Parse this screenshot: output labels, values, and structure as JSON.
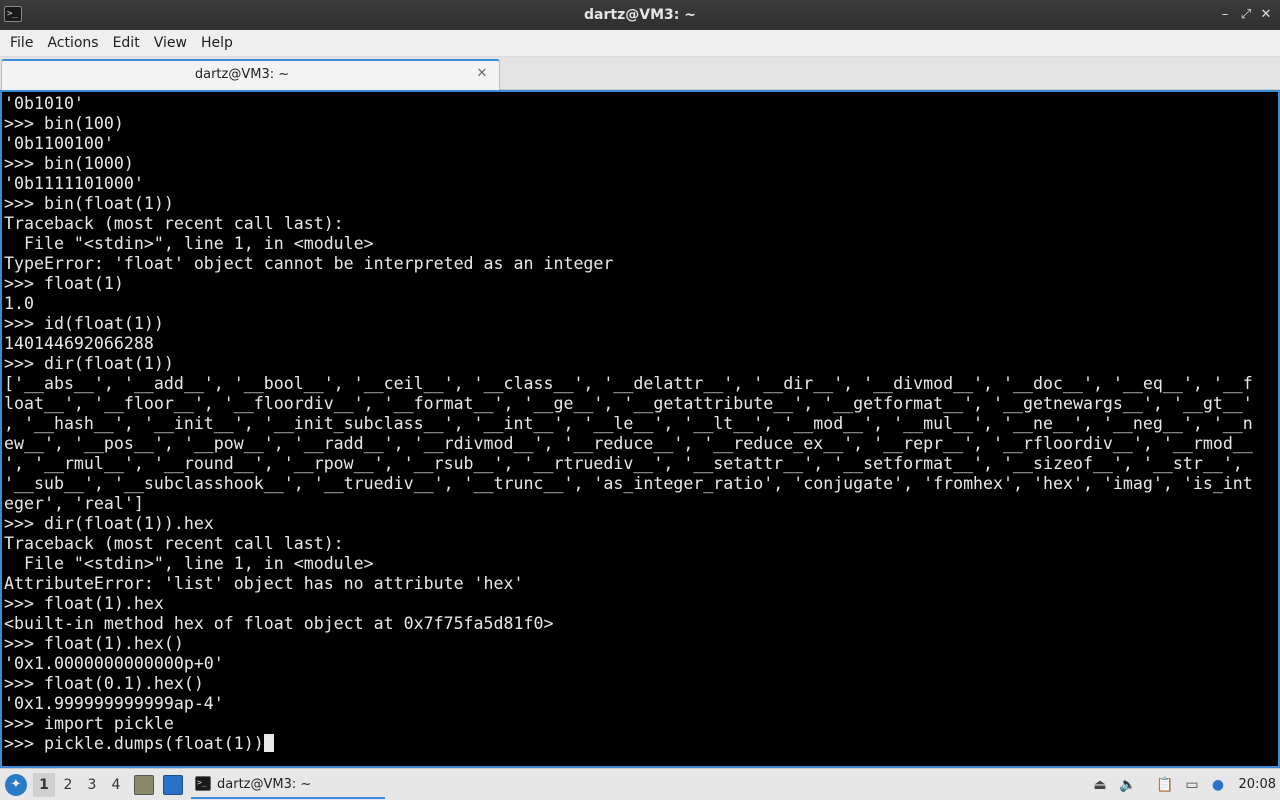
{
  "window": {
    "title": "dartz@VM3: ~",
    "controls": {
      "minimize": "–",
      "maximize": "⤢",
      "close": "✕"
    }
  },
  "menu": {
    "items": [
      "File",
      "Actions",
      "Edit",
      "View",
      "Help"
    ]
  },
  "tabs": [
    {
      "label": "dartz@VM3: ~",
      "close": "✕"
    }
  ],
  "terminal": {
    "lines": [
      "'0b1010'",
      ">>> bin(100)",
      "'0b1100100'",
      ">>> bin(1000)",
      "'0b1111101000'",
      ">>> bin(float(1))",
      "Traceback (most recent call last):",
      "  File \"<stdin>\", line 1, in <module>",
      "TypeError: 'float' object cannot be interpreted as an integer",
      ">>> float(1)",
      "1.0",
      ">>> id(float(1))",
      "140144692066288",
      ">>> dir(float(1))",
      "['__abs__', '__add__', '__bool__', '__ceil__', '__class__', '__delattr__', '__dir__', '__divmod__', '__doc__', '__eq__', '__f",
      "loat__', '__floor__', '__floordiv__', '__format__', '__ge__', '__getattribute__', '__getformat__', '__getnewargs__', '__gt__'",
      ", '__hash__', '__init__', '__init_subclass__', '__int__', '__le__', '__lt__', '__mod__', '__mul__', '__ne__', '__neg__', '__n",
      "ew__', '__pos__', '__pow__', '__radd__', '__rdivmod__', '__reduce__', '__reduce_ex__', '__repr__', '__rfloordiv__', '__rmod__",
      "', '__rmul__', '__round__', '__rpow__', '__rsub__', '__rtruediv__', '__setattr__', '__setformat__', '__sizeof__', '__str__',",
      "'__sub__', '__subclasshook__', '__truediv__', '__trunc__', 'as_integer_ratio', 'conjugate', 'fromhex', 'hex', 'imag', 'is_int",
      "eger', 'real']",
      ">>> dir(float(1)).hex",
      "Traceback (most recent call last):",
      "  File \"<stdin>\", line 1, in <module>",
      "AttributeError: 'list' object has no attribute 'hex'",
      ">>> float(1).hex",
      "<built-in method hex of float object at 0x7f75fa5d81f0>",
      ">>> float(1).hex()",
      "'0x1.0000000000000p+0'",
      ">>> float(0.1).hex()",
      "'0x1.999999999999ap-4'",
      ">>> import pickle"
    ],
    "current_input": ">>> pickle.dumps(float(1))"
  },
  "taskbar": {
    "workspaces": [
      "1",
      "2",
      "3",
      "4"
    ],
    "active_workspace": "1",
    "task_label": "dartz@VM3: ~",
    "clock": "20:08"
  },
  "colors": {
    "terminal_bg": "#000000",
    "terminal_fg": "#e8e8e8",
    "accent": "#3c8dde"
  }
}
